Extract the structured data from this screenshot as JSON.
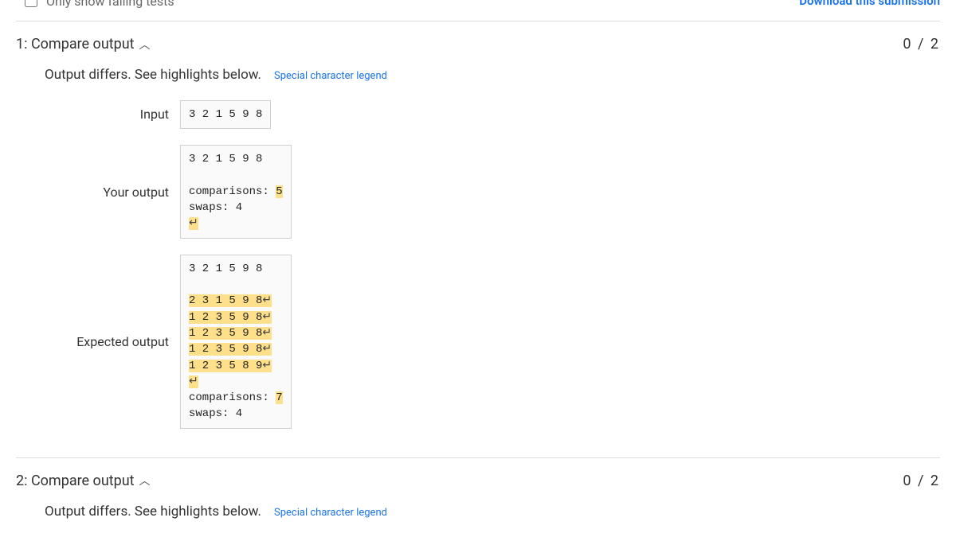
{
  "top": {
    "checkbox_label": "Only show failing tests",
    "download_label": "Download this submission"
  },
  "tests": [
    {
      "title": "1: Compare output",
      "score": "0 / 2",
      "message": "Output differs. See highlights below.",
      "legend": "Special character legend",
      "input_label": "Input",
      "input_value": "3 2 1 5 9 8",
      "your_label": "Your output",
      "expected_label": "Expected output",
      "your": {
        "line1": "3 2 1 5 9 8",
        "comp_prefix": "comparisons: ",
        "comp_hl": "5",
        "swaps": "swaps: 4"
      },
      "expected": {
        "line1": "3 2 1 5 9 8",
        "rows": [
          {
            "a": "2",
            "rest": " 3 1 5 9 8"
          },
          {
            "a": "1",
            "rest": " 2 3 5 9 8"
          },
          {
            "a": "1",
            "rest": " 2 3 5 9 8"
          },
          {
            "a": "1",
            "rest": " 2 3 5 9 8"
          },
          {
            "a": "1",
            "rest": " 2 3 5 8 9"
          }
        ],
        "comp_prefix": "comparisons: ",
        "comp_hl": "7",
        "swaps": "swaps: 4"
      }
    },
    {
      "title": "2: Compare output",
      "score": "0 / 2",
      "message": "Output differs. See highlights below.",
      "legend": "Special character legend"
    }
  ],
  "glyphs": {
    "newline": "↵"
  }
}
